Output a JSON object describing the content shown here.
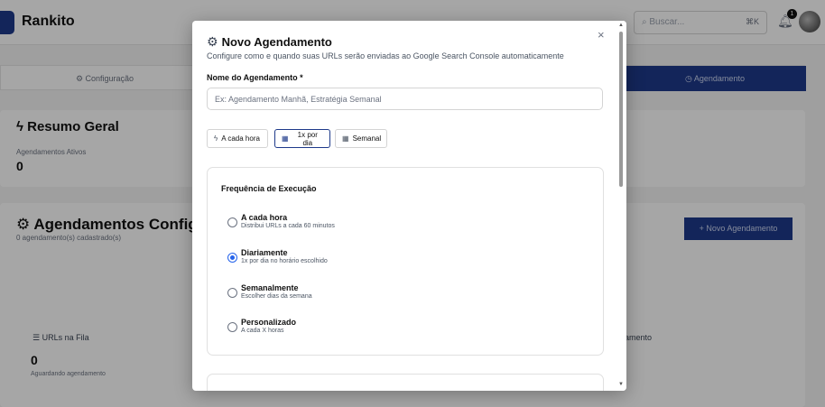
{
  "app": {
    "brand": "Rankito",
    "search_placeholder": "Buscar...",
    "search_shortcut": "⌘K",
    "notification_count": "1"
  },
  "tabs": [
    {
      "icon": "gear-icon",
      "label": "Configuração"
    },
    {
      "icon": "clock-icon",
      "label": "Agendamento"
    }
  ],
  "summary": {
    "title": "Resumo Geral",
    "active_label": "Agendamentos Ativos",
    "active_value": "0"
  },
  "schedules": {
    "title": "Agendamentos Configurados",
    "subtitle": "0 agendamento(s) cadastrado(s)",
    "new_button": "+ Novo Agendamento",
    "queue_label": "URLs na Fila",
    "queue_value": "0",
    "queue_sub": "Aguardando agendamento",
    "right_label_fragment": "amento"
  },
  "modal": {
    "title": "Novo Agendamento",
    "description": "Configure como e quando suas URLs serão enviadas ao Google Search Console automaticamente",
    "close": "×",
    "name_label": "Nome do Agendamento *",
    "name_placeholder": "Ex: Agendamento Manhã, Estratégia Semanal",
    "name_value": "",
    "quick_buttons": [
      {
        "icon": "bolt-icon",
        "label": "A cada hora",
        "selected": false
      },
      {
        "icon": "calendar-icon",
        "label": "1x por dia",
        "selected": true
      },
      {
        "icon": "calendar-icon",
        "label": "Semanal",
        "selected": false
      }
    ],
    "frequency": {
      "title": "Frequência de Execução",
      "options": [
        {
          "title": "A cada hora",
          "desc": "Distribui URLs a cada 60 minutos",
          "checked": false
        },
        {
          "title": "Diariamente",
          "desc": "1x por dia no horário escolhido",
          "checked": true
        },
        {
          "title": "Semanalmente",
          "desc": "Escolher dias da semana",
          "checked": false
        },
        {
          "title": "Personalizado",
          "desc": "A cada X horas",
          "checked": false
        }
      ]
    }
  },
  "colors": {
    "primary": "#1e3a8a",
    "radio_accent": "#2563eb"
  }
}
